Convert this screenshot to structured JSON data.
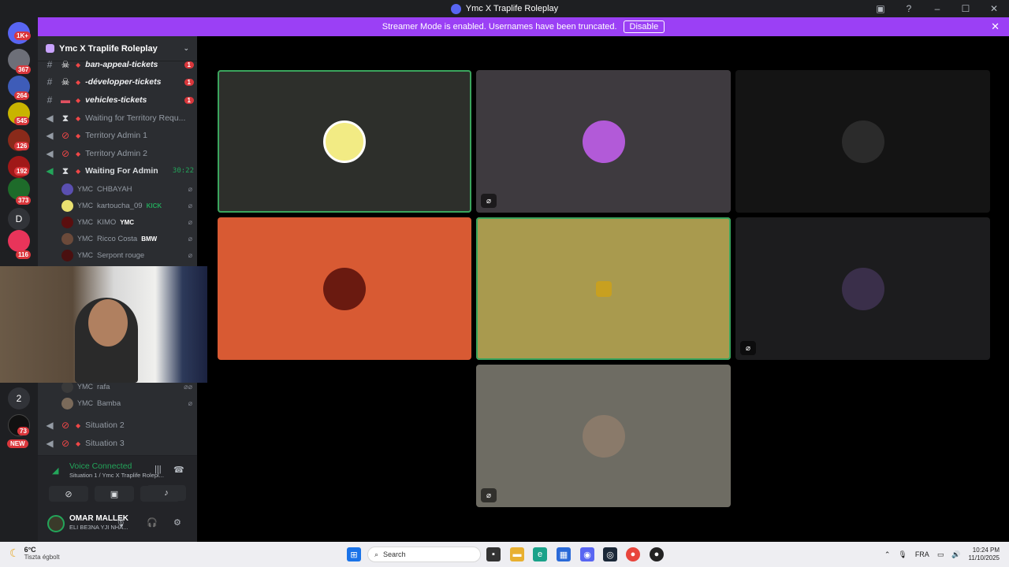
{
  "window": {
    "title": "Ymc X Traplife Roleplay"
  },
  "banner": {
    "text": "Streamer Mode is enabled. Usernames have been truncated.",
    "button": "Disable"
  },
  "rail": {
    "badges": [
      "1K+",
      "367",
      "264",
      "545",
      "126",
      "192",
      "373",
      "116",
      "73"
    ],
    "letters": [
      "D",
      "2"
    ],
    "new_label": "NEW"
  },
  "server": {
    "name": "Ymc X Traplife Roleplay"
  },
  "channels": [
    {
      "name": "ban-appeal-tickets",
      "unread": "1"
    },
    {
      "name": "-développer-tickets",
      "unread": "1"
    },
    {
      "name": "vehicles-tickets",
      "unread": "1"
    },
    {
      "name": "Waiting for Territory Requ..."
    },
    {
      "name": "Territory Admin 1"
    },
    {
      "name": "Territory Admin 2"
    },
    {
      "name": "Waiting For Admin",
      "timer": "30:22"
    }
  ],
  "members": [
    {
      "tag": "YMC",
      "name": "CHBAYAH",
      "extra": ""
    },
    {
      "tag": "YMC",
      "name": "kartoucha_09",
      "extra": "KICK"
    },
    {
      "tag": "YMC",
      "name": "KIMO",
      "extra": "YMC"
    },
    {
      "tag": "YMC",
      "name": "Ricco Costa",
      "extra": "BMW"
    },
    {
      "tag": "YMC",
      "name": "Serpont rouge",
      "extra": ""
    },
    {
      "tag": "YMC",
      "name": "rafa",
      "extra": ""
    },
    {
      "tag": "YMC",
      "name": "Bamba",
      "extra": ""
    }
  ],
  "lower_channels": [
    {
      "name": "Situation 2"
    },
    {
      "name": "Situation 3"
    }
  ],
  "voice": {
    "status": "Voice Connected",
    "location": "Situation 1 / Ymc X Traplife Rolepl..."
  },
  "user": {
    "name": "OMAR MALLEK",
    "status": "ELI BE3NA YJI NHA..."
  },
  "taskbar": {
    "temp": "6°C",
    "weather": "Tiszta égbolt",
    "search": "Search",
    "lang": "FRA",
    "time": "10:24 PM",
    "date": "11/10/2025"
  },
  "colors": {
    "banner": "#9b40f5",
    "speaking": "#3ba55d",
    "badge": "#da373c"
  }
}
